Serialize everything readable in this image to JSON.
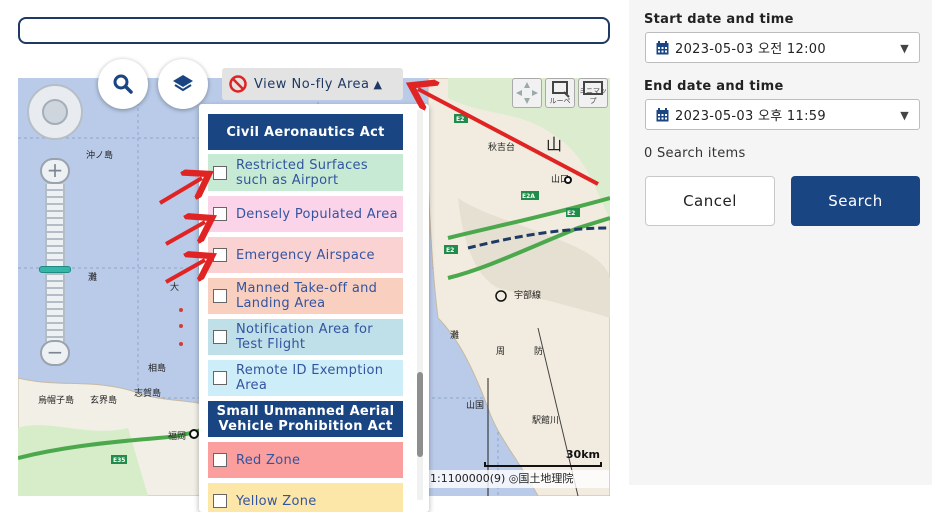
{
  "search": {
    "placeholder": "",
    "value": ""
  },
  "map_controls": {
    "search_icon": "search-icon",
    "layers_icon": "layers-icon",
    "nofly_button": {
      "label": "View No-fly Area",
      "icon": "no-entry-icon",
      "arrow": "▲"
    },
    "zoom_plus": "+",
    "zoom_minus": "−",
    "tool_loupe": "ルーペ",
    "tool_minimap": "ミニマップ"
  },
  "nofly_panel": {
    "items": [
      {
        "kind": "header",
        "label": "Civil Aeronautics Act",
        "color": "#1a4583"
      },
      {
        "kind": "check",
        "label": "Restricted Surfaces such as Airport",
        "color": "#c6ead3",
        "checked": false
      },
      {
        "kind": "check",
        "label": "Densely Populated Area",
        "color": "#fbd4ea",
        "checked": false
      },
      {
        "kind": "check",
        "label": "Emergency Airspace",
        "color": "#fbd2d2",
        "checked": false
      },
      {
        "kind": "check",
        "label": "Manned Take-off and Landing Area",
        "color": "#f9d0c0",
        "checked": false
      },
      {
        "kind": "check",
        "label": "Notification Area for Test Flight",
        "color": "#bfdfe9",
        "checked": false
      },
      {
        "kind": "check",
        "label": "Remote ID Exemption Area",
        "color": "#cdeef8",
        "checked": false
      },
      {
        "kind": "header",
        "label": "Small Unmanned Aerial Vehicle Prohibition Act",
        "color": "#1a4583"
      },
      {
        "kind": "check",
        "label": "Red Zone",
        "color": "#fa9e9e",
        "checked": false
      },
      {
        "kind": "check",
        "label": "Yellow Zone",
        "color": "#fde7a8",
        "checked": false
      }
    ]
  },
  "map": {
    "scale_label": "30km",
    "attribution": "1:1100000(9)  ◎国土地理院",
    "labels": [
      {
        "text": "沖ノ島"
      },
      {
        "text": "相島"
      },
      {
        "text": "志賀島"
      },
      {
        "text": "玄界島"
      },
      {
        "text": "烏帽子島"
      },
      {
        "text": "福岡"
      },
      {
        "text": "山"
      },
      {
        "text": "秋吉台"
      },
      {
        "text": "山口"
      },
      {
        "text": "周"
      },
      {
        "text": "防"
      },
      {
        "text": "灘"
      },
      {
        "text": "山国"
      },
      {
        "text": "駅館川"
      },
      {
        "text": "宇部線"
      },
      {
        "text": "大"
      },
      {
        "text": "灘"
      }
    ],
    "road_badges": [
      "E2",
      "E2A",
      "E2",
      "E2",
      "E35"
    ]
  },
  "filters": {
    "start": {
      "label": "Start date and time",
      "value": "2023-05-03 오전 12:00"
    },
    "end": {
      "label": "End date and time",
      "value": "2023-05-03 오후 11:59"
    },
    "count": "0 Search items",
    "cancel_label": "Cancel",
    "search_label": "Search"
  },
  "colors": {
    "primary": "#1a4583",
    "annotation_arrow": "#e02424"
  }
}
